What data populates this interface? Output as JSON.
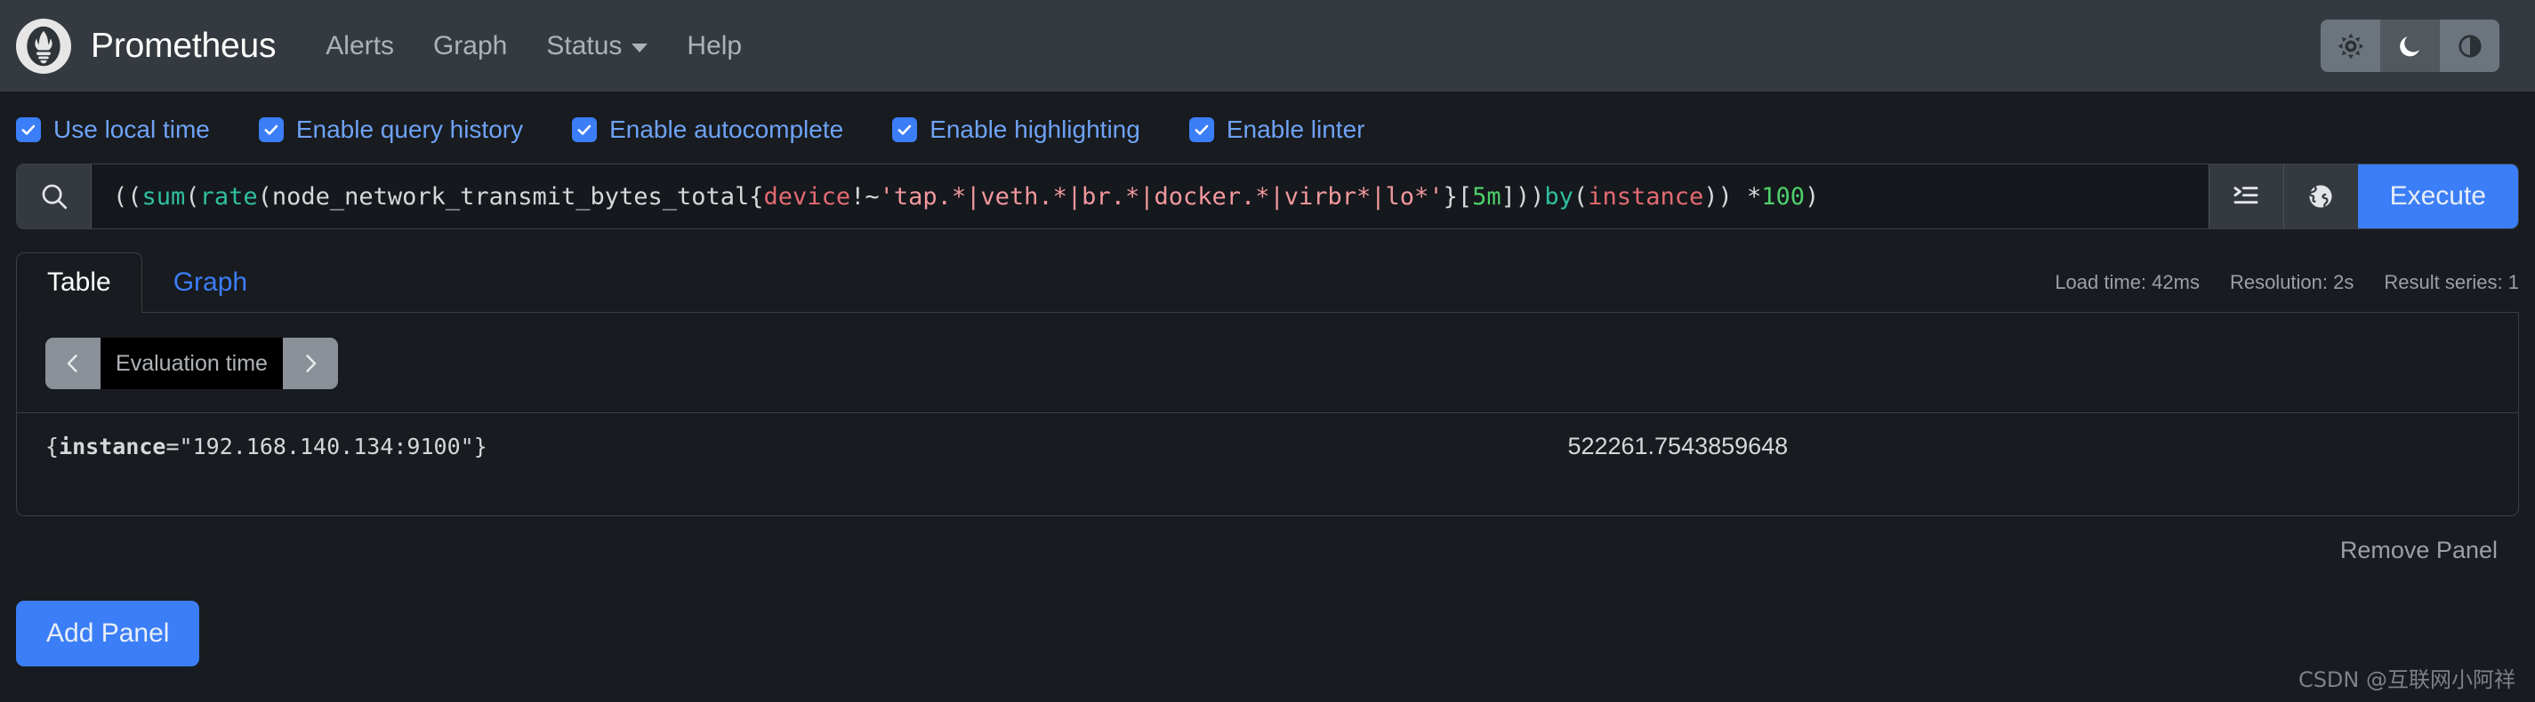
{
  "navbar": {
    "logo_icon": "prometheus-torch-logo",
    "brand": "Prometheus",
    "links": [
      {
        "label": "Alerts",
        "icon": ""
      },
      {
        "label": "Graph",
        "icon": ""
      },
      {
        "label": "Status",
        "icon": "chevron-down-icon"
      },
      {
        "label": "Help",
        "icon": ""
      }
    ],
    "theme_buttons": [
      {
        "name": "light-theme-button",
        "icon": "sun-icon",
        "active": false
      },
      {
        "name": "dark-theme-button",
        "icon": "moon-icon",
        "active": true
      },
      {
        "name": "auto-theme-button",
        "icon": "contrast-icon",
        "active": false
      }
    ]
  },
  "options": [
    {
      "label": "Use local time",
      "checked": true
    },
    {
      "label": "Enable query history",
      "checked": true
    },
    {
      "label": "Enable autocomplete",
      "checked": true
    },
    {
      "label": "Enable highlighting",
      "checked": true
    },
    {
      "label": "Enable linter",
      "checked": true
    }
  ],
  "query": {
    "search_icon": "search-icon",
    "expression": "((sum(rate (node_network_transmit_bytes_total{device!~'tap.*|veth.*|br.*|docker.*|virbr*|lo*'}[5m])) by (instance)) * 100)",
    "tokens": [
      {
        "t": "((",
        "c": "plain"
      },
      {
        "t": "sum",
        "c": "fn"
      },
      {
        "t": "(",
        "c": "plain"
      },
      {
        "t": "rate",
        "c": "fn"
      },
      {
        "t": " (node_network_transmit_bytes_total{",
        "c": "plain"
      },
      {
        "t": "device",
        "c": "label"
      },
      {
        "t": "!~",
        "c": "plain"
      },
      {
        "t": "'tap.*|veth.*|br.*|docker.*|virbr*|lo*'",
        "c": "str"
      },
      {
        "t": "}",
        "c": "plain"
      },
      {
        "t": "[",
        "c": "plain"
      },
      {
        "t": "5m",
        "c": "num"
      },
      {
        "t": "]",
        "c": "plain"
      },
      {
        "t": ")) ",
        "c": "plain"
      },
      {
        "t": "by",
        "c": "fn"
      },
      {
        "t": " (",
        "c": "plain"
      },
      {
        "t": "instance",
        "c": "label"
      },
      {
        "t": ")) * ",
        "c": "plain"
      },
      {
        "t": "100",
        "c": "num"
      },
      {
        "t": ")",
        "c": "plain"
      }
    ],
    "metrics_explorer_icon": "metrics-explorer-icon",
    "globe_icon": "globe-icon",
    "execute_label": "Execute"
  },
  "tabs": [
    {
      "label": "Table",
      "active": true
    },
    {
      "label": "Graph",
      "active": false
    }
  ],
  "stats": {
    "load_time": "Load time: 42ms",
    "resolution": "Resolution: 2s",
    "result_series": "Result series: 1"
  },
  "evaluation_time": {
    "prev_icon": "chevron-left-icon",
    "next_icon": "chevron-right-icon",
    "placeholder": "Evaluation time",
    "value": ""
  },
  "result": {
    "rows": [
      {
        "label_key": "instance",
        "label_value": "\"192.168.140.134:9100\"",
        "series_prefix": "{",
        "series_suffix": "}",
        "value": "522261.7543859648"
      }
    ]
  },
  "footer": {
    "remove_panel": "Remove Panel",
    "add_panel": "Add Panel",
    "watermark": "CSDN @互联网小阿祥"
  },
  "colors": {
    "accent_blue": "#3b7ef7",
    "navbar_bg": "#343a40",
    "page_bg": "#181b1f",
    "token_fn": "#2fbfa0",
    "token_label": "#e36b72",
    "token_string": "#f0989e",
    "token_number": "#4fcf6b"
  }
}
